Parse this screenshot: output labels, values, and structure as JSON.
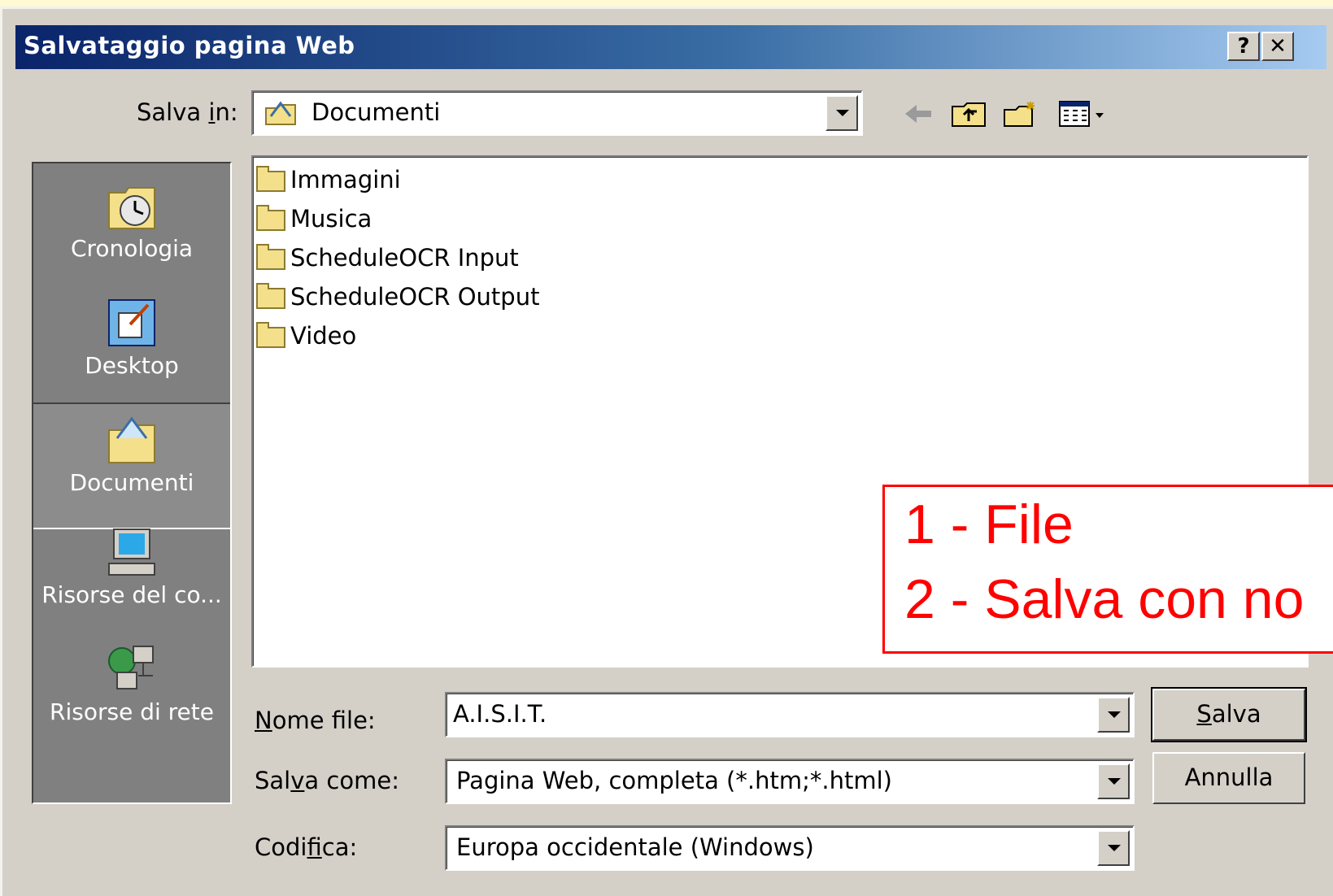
{
  "window": {
    "title": "Salvataggio pagina Web",
    "help_label": "?",
    "close_label": "✕"
  },
  "save_in": {
    "label": "Salva in:",
    "value": "Documenti"
  },
  "toolbar": {
    "icons": [
      "back-arrow-icon",
      "folder-up-icon",
      "new-folder-icon",
      "view-menu-icon"
    ]
  },
  "places": [
    {
      "label": "Cronologia"
    },
    {
      "label": "Desktop"
    },
    {
      "label": "Documenti"
    },
    {
      "label": "Risorse del co..."
    },
    {
      "label": "Risorse di rete"
    }
  ],
  "files": [
    {
      "name": "Immagini"
    },
    {
      "name": "Musica"
    },
    {
      "name": "ScheduleOCR Input"
    },
    {
      "name": "ScheduleOCR Output"
    },
    {
      "name": "Video"
    }
  ],
  "form": {
    "filename_label": "Nome file:",
    "filename_value": "A.I.S.I.T.",
    "savetype_label": "Salva come:",
    "savetype_value": "Pagina Web, completa (*.htm;*.html)",
    "encoding_label": "Codifica:",
    "encoding_value": "Europa occidentale (Windows)"
  },
  "buttons": {
    "save": "Salva",
    "cancel": "Annulla"
  },
  "annotation": {
    "line1": "1 - File",
    "line2": "2 - Salva con no"
  }
}
